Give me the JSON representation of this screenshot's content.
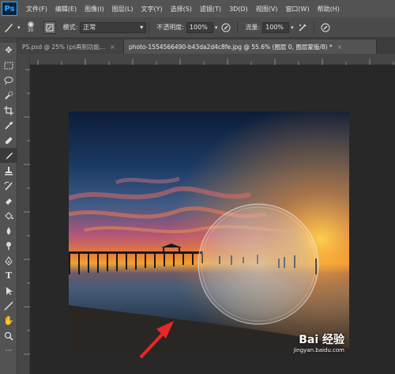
{
  "app": {
    "logo": "Ps"
  },
  "menu": [
    "文件(F)",
    "编辑(E)",
    "图像(I)",
    "图层(L)",
    "文字(Y)",
    "选择(S)",
    "滤镜(T)",
    "3D(D)",
    "视图(V)",
    "窗口(W)",
    "帮助(H)"
  ],
  "options": {
    "brush_size": "30",
    "mode_label": "模式:",
    "mode_value": "正常",
    "opacity_label": "不透明度:",
    "opacity_value": "100%",
    "flow_label": "流量:",
    "flow_value": "100%"
  },
  "tabs": [
    {
      "label": "PS.psd @ 25% (ps再制功能...",
      "close": "×",
      "active": false
    },
    {
      "label": "photo-1554566490-b43da2d4c8fe.jpg @ 55.6% (图层 0, 图层蒙版/8) *",
      "close": "×",
      "active": true
    }
  ],
  "tools": [
    "move-icon",
    "marquee-icon",
    "lasso-icon",
    "quick-select-icon",
    "crop-icon",
    "eyedropper-icon",
    "healing-icon",
    "brush-icon",
    "clone-stamp-icon",
    "history-brush-icon",
    "eraser-icon",
    "paint-bucket-icon",
    "blur-icon",
    "dodge-icon",
    "pen-icon",
    "type-icon",
    "path-select-icon",
    "line-icon",
    "hand-icon",
    "zoom-icon"
  ],
  "watermark": {
    "text": "Bai 经验",
    "url": "jingyan.baidu.com"
  },
  "colors": {
    "menubar": "#535353",
    "optionsbar": "#4b4b4b",
    "workspace": "#282828",
    "accent": "#31a8ff",
    "arrow": "#e8262a"
  }
}
